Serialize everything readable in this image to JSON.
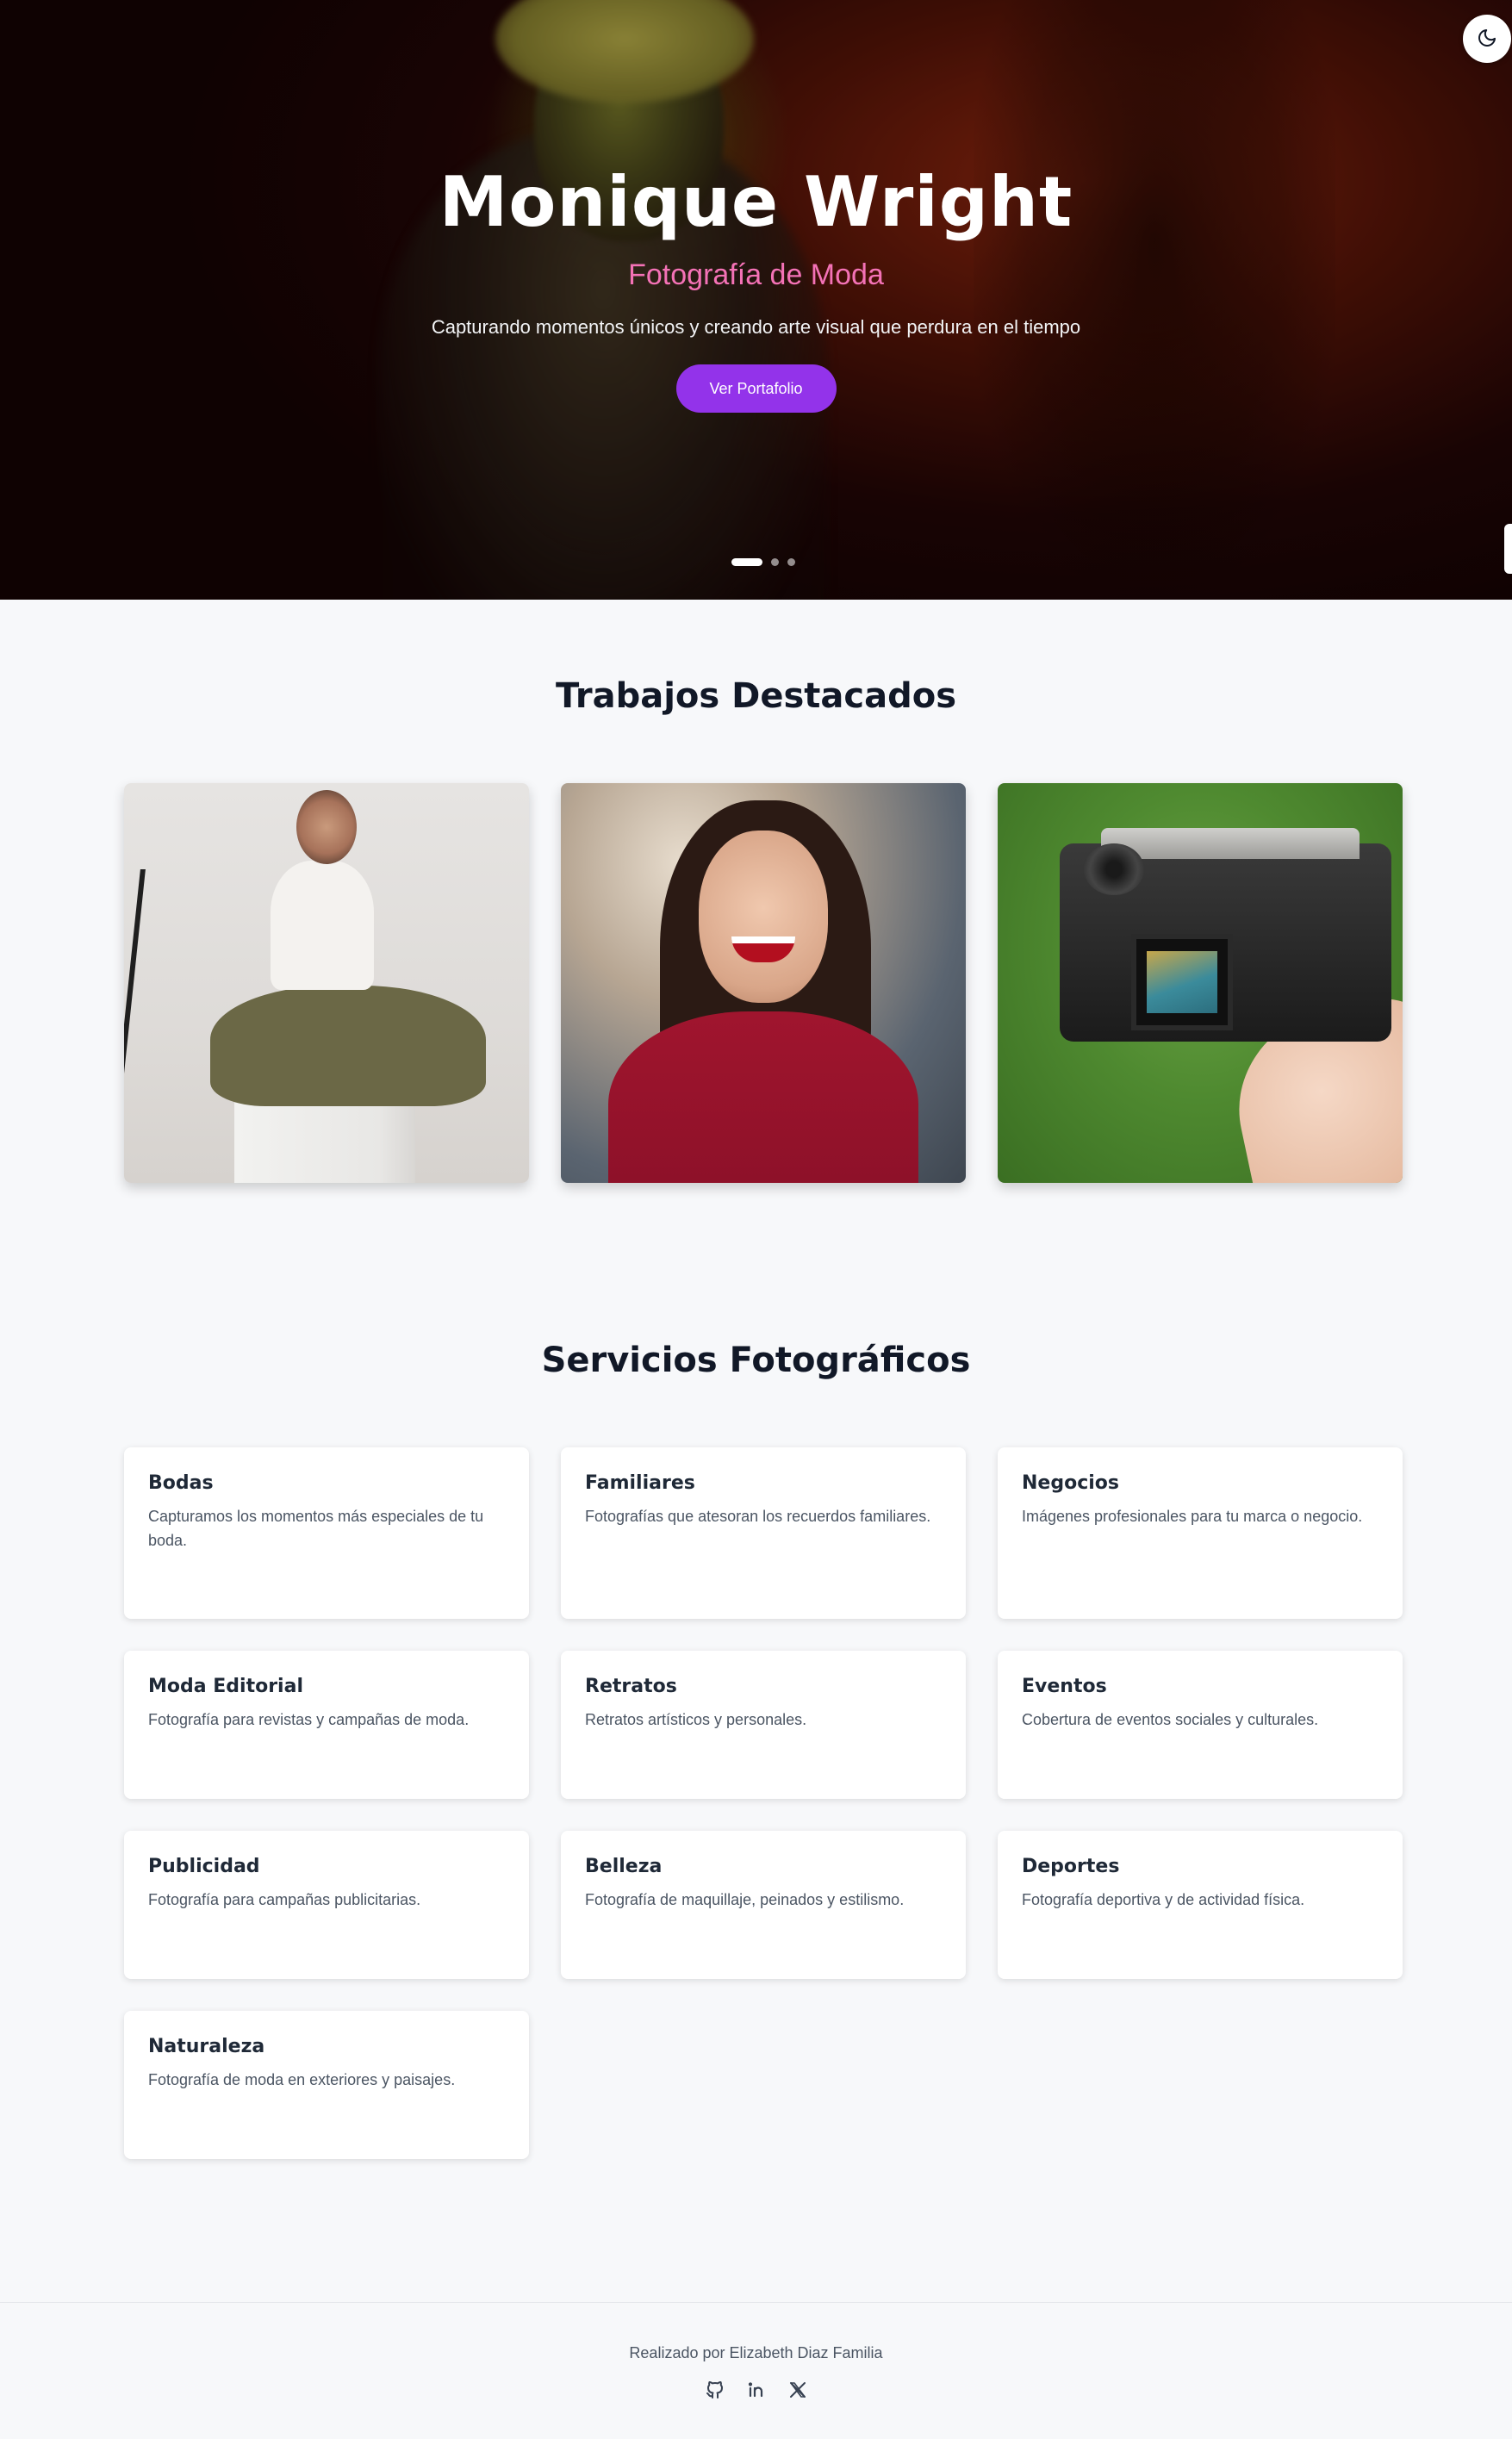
{
  "hero": {
    "title": "Monique Wright",
    "subtitle": "Fotografía de Moda",
    "tagline": "Capturando momentos únicos y creando arte visual que perdura en el tiempo",
    "cta_label": "Ver Portafolio",
    "slides": 3,
    "active_slide": 1
  },
  "theme_toggle": {
    "icon": "moon-icon"
  },
  "featured": {
    "title": "Trabajos Destacados",
    "photos": [
      {
        "subject": "woman-sitting-studio"
      },
      {
        "subject": "smiling-woman-portrait"
      },
      {
        "subject": "camera-in-hand"
      }
    ]
  },
  "services": {
    "title": "Servicios Fotográficos",
    "items": [
      {
        "title": "Bodas",
        "description": "Capturamos los momentos más especiales de tu boda."
      },
      {
        "title": "Familiares",
        "description": "Fotografías que atesoran los recuerdos familiares."
      },
      {
        "title": "Negocios",
        "description": "Imágenes profesionales para tu marca o negocio."
      },
      {
        "title": "Moda Editorial",
        "description": "Fotografía para revistas y campañas de moda."
      },
      {
        "title": "Retratos",
        "description": "Retratos artísticos y personales."
      },
      {
        "title": "Eventos",
        "description": "Cobertura de eventos sociales y culturales."
      },
      {
        "title": "Publicidad",
        "description": "Fotografía para campañas publicitarias."
      },
      {
        "title": "Belleza",
        "description": "Fotografía de maquillaje, peinados y estilismo."
      },
      {
        "title": "Deportes",
        "description": "Fotografía deportiva y de actividad física."
      },
      {
        "title": "Naturaleza",
        "description": "Fotografía de moda en exteriores y paisajes."
      }
    ]
  },
  "footer": {
    "credit": "Realizado por Elizabeth Diaz Familia",
    "social": [
      {
        "icon": "github-icon"
      },
      {
        "icon": "linkedin-icon"
      },
      {
        "icon": "x-icon"
      }
    ]
  },
  "colors": {
    "accent": "#9333ea",
    "subtitle_pink": "#f472b6",
    "page_bg": "#f7f8fa"
  }
}
